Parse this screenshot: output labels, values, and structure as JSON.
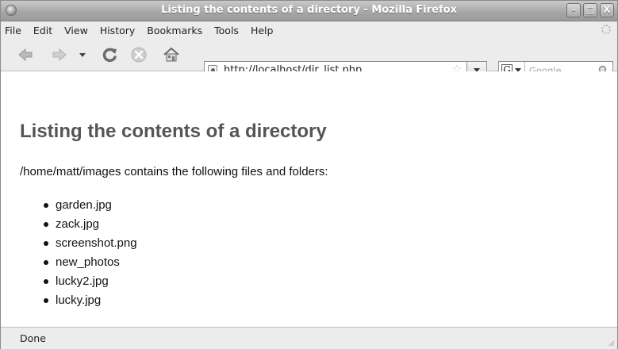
{
  "window": {
    "title": "Listing the contents of a directory - Mozilla Firefox",
    "controls": {
      "minimize": "–",
      "maximize": "□",
      "close": "X"
    }
  },
  "menu": [
    "File",
    "Edit",
    "View",
    "History",
    "Bookmarks",
    "Tools",
    "Help"
  ],
  "toolbar": {
    "icons": [
      "back-icon",
      "forward-icon",
      "history-dropdown-icon",
      "reload-icon",
      "stop-icon",
      "home-icon"
    ],
    "url": "http://localhost/dir_list.php",
    "search_engine_label": "G",
    "search_placeholder": "Google"
  },
  "page": {
    "heading": "Listing the contents of a directory",
    "intro": "/home/matt/images contains the following files and folders:",
    "entries": [
      "garden.jpg",
      "zack.jpg",
      "screenshot.png",
      "new_photos",
      "lucky2.jpg",
      "lucky.jpg"
    ]
  },
  "status": {
    "text": "Done"
  },
  "colors": {
    "titlebar": "#a8a8a8",
    "chrome": "#ececec",
    "heading": "#555555"
  }
}
